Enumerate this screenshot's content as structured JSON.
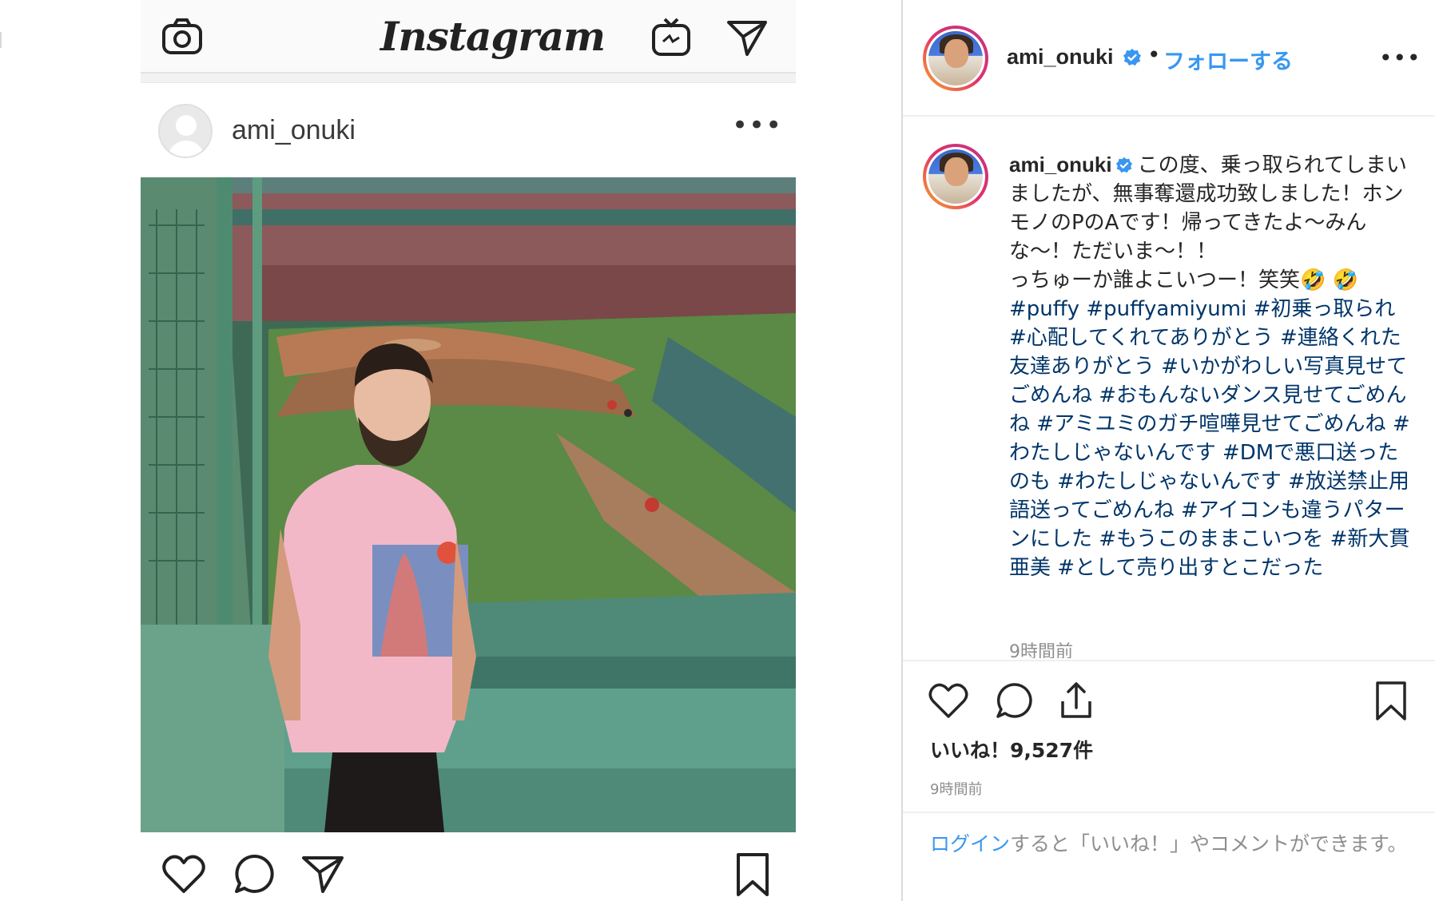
{
  "mobile": {
    "wordmark": "Instagram",
    "post_username": "ami_onuki",
    "more": "•••",
    "icons": {
      "camera": "camera-icon",
      "igtv": "igtv-icon",
      "direct": "direct-icon",
      "like": "heart-icon",
      "comment": "comment-icon",
      "share": "send-icon",
      "save": "bookmark-icon"
    }
  },
  "desktop": {
    "username": "ami_onuki",
    "separator": "•",
    "follow_label": "フォローする",
    "more": "•••",
    "caption": {
      "username": "ami_onuki",
      "text": "この度、乗っ取られてしまいましたが、無事奪還成功致しました！ホンモノのPのAです！帰ってきたよ〜みんな〜！ただいま〜！！",
      "text2": "っちゅーか誰よこいつー！笑笑🤣 🤣",
      "tags": [
        "#puffy",
        "#puffyamiyumi",
        "#初乗っ取られ",
        "#心配してくれてありがとう",
        "#連絡くれた友達ありがとう",
        "#いかがわしい写真見せてごめんね",
        "#おもんないダンス見せてごめんね",
        "#アミユミのガチ喧嘩見せてごめんね",
        "#わたしじゃないんです",
        "#DMで悪口送ったのも",
        "#わたしじゃないんです",
        "#放送禁止用語送ってごめんね",
        "#アイコンも違うパターンにした",
        "#もうこのままこいつを",
        "#新大貫亜美",
        "#として売り出すとこだった"
      ],
      "time": "9時間前"
    },
    "likes": "いいね！9,527件",
    "time": "9時間前",
    "login_link": "ログイン",
    "login_rest": "すると「いいね！」やコメントができます。",
    "colors": {
      "link": "#3897f0",
      "hashtag": "#003569",
      "verified": "#3897f0",
      "muted": "#8e8e8e"
    }
  }
}
